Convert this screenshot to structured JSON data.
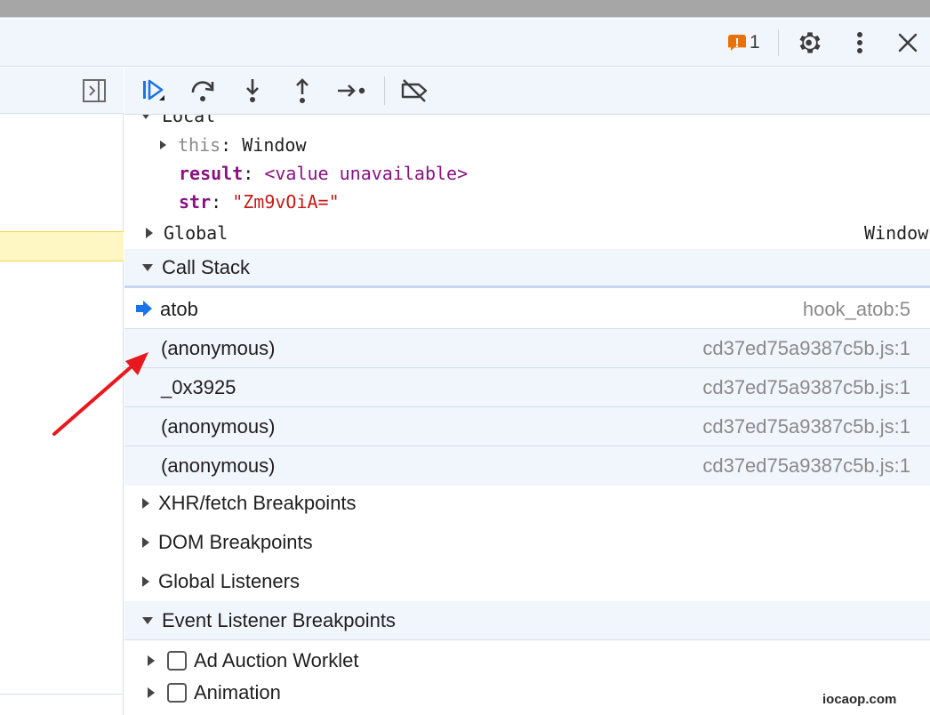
{
  "header": {
    "issues_count": "1",
    "warn_glyph": "!"
  },
  "scope": {
    "local_label": "Local",
    "this_key": "this",
    "this_value": "Window",
    "result_key": "result",
    "result_value": "<value unavailable>",
    "str_key": "str",
    "str_value": "\"Zm9vOiA=\"",
    "global_label": "Global",
    "global_value": "Window"
  },
  "sections": {
    "call_stack": "Call Stack",
    "xhr": "XHR/fetch Breakpoints",
    "dom": "DOM Breakpoints",
    "global_listeners": "Global Listeners",
    "event_listener": "Event Listener Breakpoints"
  },
  "call_stack": [
    {
      "name": "atob",
      "location": "hook_atob:5",
      "active": true
    },
    {
      "name": "(anonymous)",
      "location": "cd37ed75a9387c5b.js:1",
      "active": false
    },
    {
      "name": "_0x3925",
      "location": "cd37ed75a9387c5b.js:1",
      "active": false
    },
    {
      "name": "(anonymous)",
      "location": "cd37ed75a9387c5b.js:1",
      "active": false
    },
    {
      "name": "(anonymous)",
      "location": "cd37ed75a9387c5b.js:1",
      "active": false
    }
  ],
  "event_listeners": [
    {
      "label": "Ad Auction Worklet"
    },
    {
      "label": "Animation"
    }
  ],
  "left": {
    "bottom_text": "......"
  },
  "watermark": "iocaop.com",
  "colors": {
    "accent_blue": "#1a73e8",
    "annotation_arrow": "#e8191e",
    "warning": "#e8710a"
  }
}
